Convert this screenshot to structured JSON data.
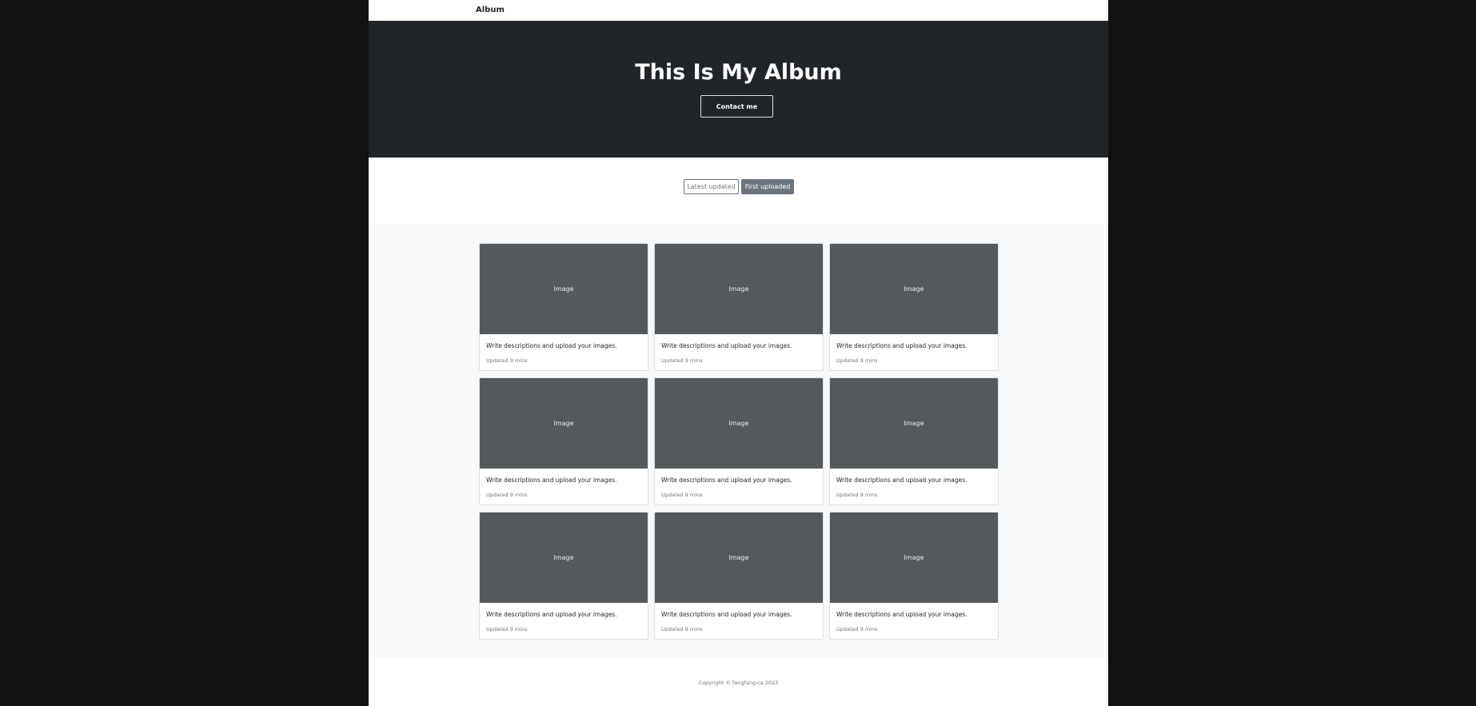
{
  "navbar": {
    "brand": "Album"
  },
  "hero": {
    "title": "This Is My Album",
    "contact_label": "Contact me"
  },
  "sort": {
    "latest_label": "Latest updated",
    "first_label": "First uploaded",
    "active": "First uploaded"
  },
  "cards": [
    {
      "image_label": "Image",
      "description": "Write descriptions and upload your images.",
      "updated": "Updated 9 mins"
    },
    {
      "image_label": "Image",
      "description": "Write descriptions and upload your images.",
      "updated": "Updated 9 mins"
    },
    {
      "image_label": "Image",
      "description": "Write descriptions and upload your images.",
      "updated": "Updated 9 mins"
    },
    {
      "image_label": "Image",
      "description": "Write descriptions and upload your images.",
      "updated": "Updated 9 mins"
    },
    {
      "image_label": "Image",
      "description": "Write descriptions and upload your images.",
      "updated": "Updated 9 mins"
    },
    {
      "image_label": "Image",
      "description": "Write descriptions and upload your images.",
      "updated": "Updated 9 mins"
    },
    {
      "image_label": "Image",
      "description": "Write descriptions and upload your images.",
      "updated": "Updated 9 mins"
    },
    {
      "image_label": "Image",
      "description": "Write descriptions and upload your images.",
      "updated": "Updated 9 mins"
    },
    {
      "image_label": "Image",
      "description": "Write descriptions and upload your images.",
      "updated": "Updated 9 mins"
    }
  ],
  "footer": {
    "copyright": "Copyright © fangfang.ca 2023"
  },
  "colors": {
    "outer_background": "#111111",
    "hero_background": "#212529",
    "gallery_background": "#f8f9fa",
    "image_placeholder": "#55595c",
    "secondary": "#6c757d"
  }
}
